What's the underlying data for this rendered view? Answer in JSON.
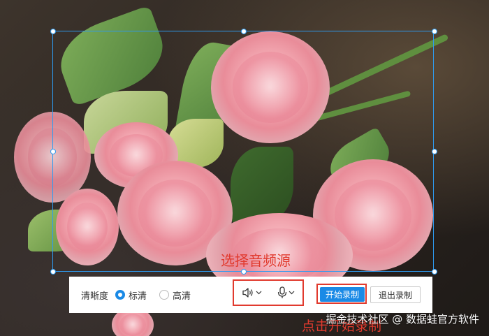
{
  "toolbar": {
    "quality_label": "清晰度",
    "quality_options": [
      "标清",
      "高清"
    ],
    "quality_selected": "标清",
    "start_button": "开始录制",
    "exit_button": "退出录制"
  },
  "annotations": {
    "select_audio": "选择音频源",
    "click_start": "点击开始录制"
  },
  "watermark": "掘金技术社区 @ 数据蛙官方软件",
  "icons": [
    "speaker-icon",
    "microphone-icon",
    "chevron-down-icon"
  ],
  "colors": {
    "selection": "#2e9bf0",
    "primary": "#1a8ae6",
    "annotation": "#e13a2e"
  }
}
